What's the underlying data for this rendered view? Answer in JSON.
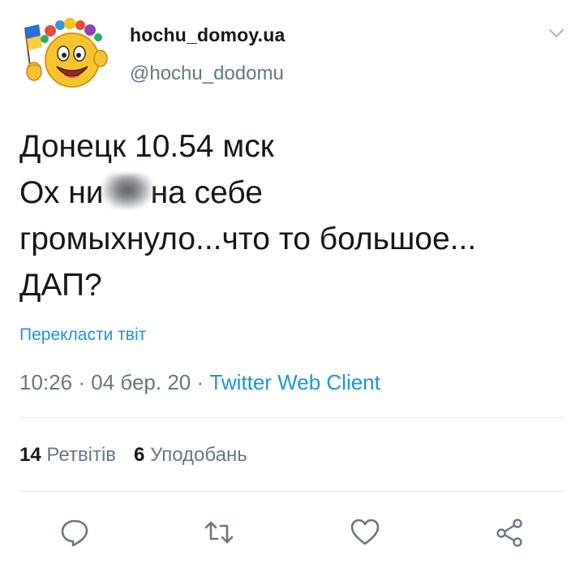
{
  "user": {
    "display_name": "hochu_domoy.ua",
    "handle": "@hochu_dodomu",
    "avatar_icon": "smiley-with-ukrainian-flag-and-flower-wreath-icon"
  },
  "tweet": {
    "line1": "Донецк 10.54 мск",
    "line2_before": "Ох ни",
    "line2_after": "на себе",
    "line3": "громыхнуло...что то большое...",
    "line4": "ДАП?"
  },
  "translate_label": "Перекласти твіт",
  "meta": {
    "time": "10:26",
    "separator1": "·",
    "date": "04 бер. 20",
    "separator2": "·",
    "client": "Twitter Web Client"
  },
  "stats": {
    "retweets_count": "14",
    "retweets_label": "Ретвітів",
    "likes_count": "6",
    "likes_label": "Уподобань"
  },
  "actions": {
    "reply_icon": "reply-icon",
    "retweet_icon": "retweet-icon",
    "like_icon": "heart-icon",
    "share_icon": "share-icon"
  },
  "colors": {
    "link": "#1b95e0",
    "secondary_text": "#657786",
    "primary_text": "#14171a",
    "divider": "#e1e8ed"
  }
}
